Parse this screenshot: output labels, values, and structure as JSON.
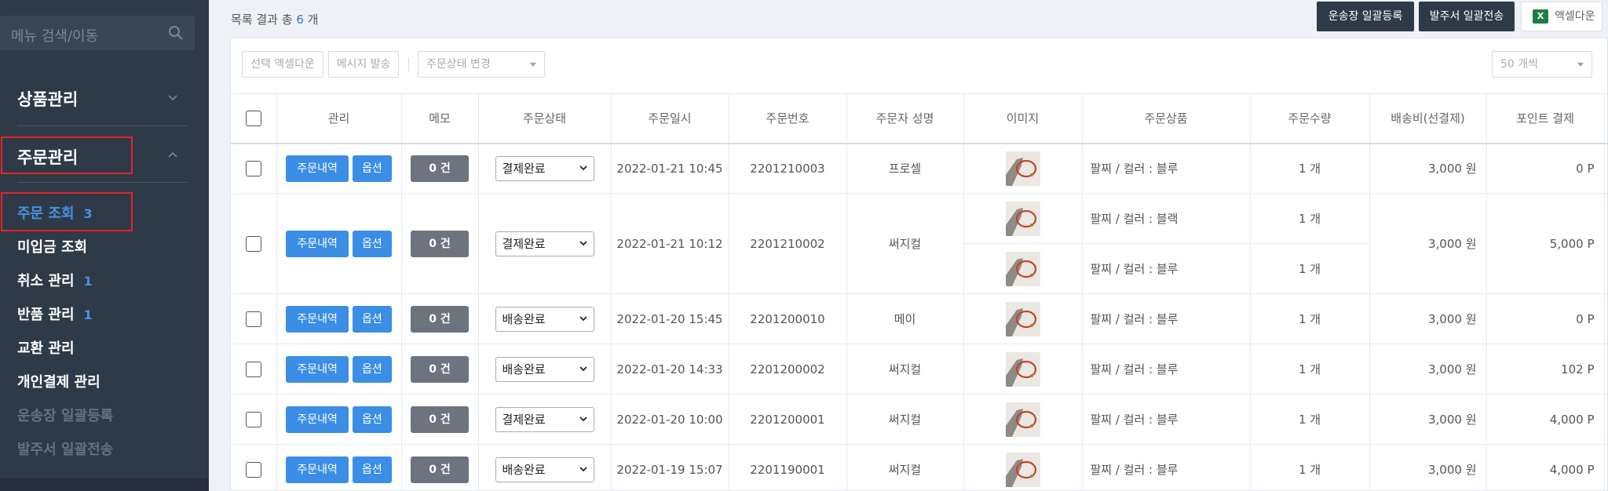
{
  "sidebar": {
    "search_placeholder": "메뉴 검색/이동",
    "menu1": "상품관리",
    "menu2": "주문관리",
    "items": [
      {
        "label": "주문 조회",
        "badge": "3"
      },
      {
        "label": "미입금 조회",
        "badge": ""
      },
      {
        "label": "취소 관리",
        "badge": "1"
      },
      {
        "label": "반품 관리",
        "badge": "1"
      },
      {
        "label": "교환 관리",
        "badge": ""
      },
      {
        "label": "개인결제 관리",
        "badge": ""
      },
      {
        "label": "운송장 일괄등록",
        "badge": ""
      },
      {
        "label": "발주서 일괄전송",
        "badge": ""
      }
    ]
  },
  "topbar": {
    "count_prefix": "목록 결과 총",
    "count": "6",
    "count_suffix": "개",
    "btn_invoice": "운송장 일괄등록",
    "btn_order_sheet": "발주서 일괄전송",
    "btn_excel": "액셀다운",
    "excel_icon": "X"
  },
  "toolbar": {
    "select_excel": "선택 액셀다운",
    "send_message": "메시지 발송",
    "status_change": "주문상태 변경",
    "per_page": "50 개씩"
  },
  "columns": [
    "관리",
    "메모",
    "주문상태",
    "주문일시",
    "주문번호",
    "주문자 성명",
    "이미지",
    "주문상품",
    "주문수량",
    "배송비(선결제)",
    "포인트 결제"
  ],
  "buttons": {
    "detail": "주문내역",
    "option": "옵션"
  },
  "orders": [
    {
      "memo": "0 건",
      "status": "결제완료",
      "date": "2022-01-21 10:45",
      "no": "2201210003",
      "name": "프로셀",
      "products": [
        {
          "name": "팔찌 / 컬러 : 블루",
          "qty": "1 개"
        }
      ],
      "shipping": "3,000 원",
      "point": "0 P"
    },
    {
      "memo": "0 건",
      "status": "결제완료",
      "date": "2022-01-21 10:12",
      "no": "2201210002",
      "name": "써지컬",
      "products": [
        {
          "name": "팔찌 / 컬러 : 블랙",
          "qty": "1 개"
        },
        {
          "name": "팔찌 / 컬러 : 블루",
          "qty": "1 개"
        }
      ],
      "shipping": "3,000 원",
      "point": "5,000 P"
    },
    {
      "memo": "0 건",
      "status": "배송완료",
      "date": "2022-01-20 15:45",
      "no": "2201200010",
      "name": "메이",
      "products": [
        {
          "name": "팔찌 / 컬러 : 블루",
          "qty": "1 개"
        }
      ],
      "shipping": "3,000 원",
      "point": "0 P"
    },
    {
      "memo": "0 건",
      "status": "배송완료",
      "date": "2022-01-20 14:33",
      "no": "2201200002",
      "name": "써지컬",
      "products": [
        {
          "name": "팔찌 / 컬러 : 블루",
          "qty": "1 개"
        }
      ],
      "shipping": "3,000 원",
      "point": "102 P"
    },
    {
      "memo": "0 건",
      "status": "결제완료",
      "date": "2022-01-20 10:00",
      "no": "2201200001",
      "name": "써지컬",
      "products": [
        {
          "name": "팔찌 / 컬러 : 블루",
          "qty": "1 개"
        }
      ],
      "shipping": "3,000 원",
      "point": "4,000 P"
    },
    {
      "memo": "0 건",
      "status": "배송완료",
      "date": "2022-01-19 15:07",
      "no": "2201190001",
      "name": "써지컬",
      "products": [
        {
          "name": "팔찌 / 컬러 : 블루",
          "qty": "1 개"
        }
      ],
      "shipping": "3,000 원",
      "point": "4,000 P"
    }
  ]
}
